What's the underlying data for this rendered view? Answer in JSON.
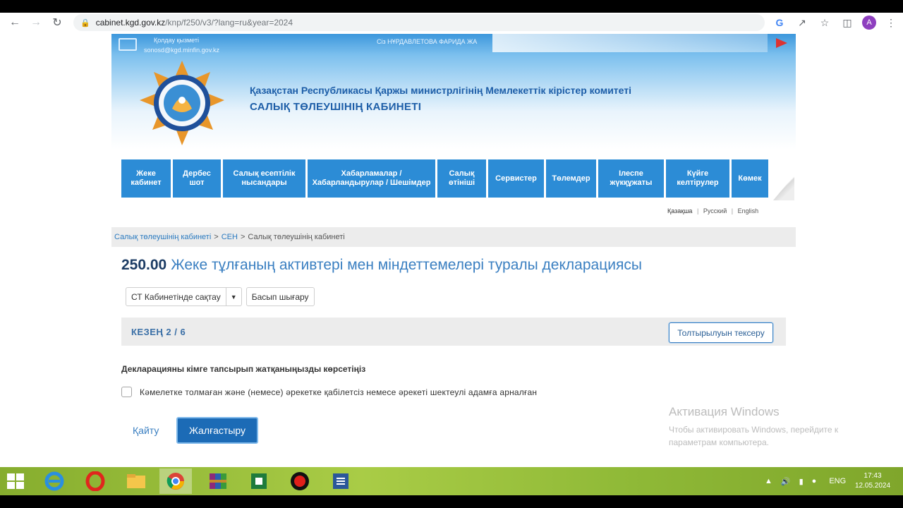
{
  "browser": {
    "url_host": "cabinet.kgd.gov.kz",
    "url_path": "/knp/f250/v3/?lang=ru&year=2024",
    "avatar_letter": "A"
  },
  "header": {
    "support_title": "Қолдау қызметі",
    "support_email": "sonosd@kgd.minfin.gov.kz",
    "user_line": "Сіз НҰРДАВЛЕТОВА ФАРИДА ЖА",
    "title_line1": "Қазақстан Республикасы Қаржы министрлігінің Мемлекеттік кірістер комитеті",
    "title_line2": "САЛЫҚ ТӨЛЕУШІНІҢ КАБИНЕТІ"
  },
  "menu": {
    "items": [
      {
        "label": "Жеке кабинет"
      },
      {
        "label": "Дербес шот"
      },
      {
        "label": "Салық есептілік нысандары"
      },
      {
        "label": "Хабарламалар / Хабарландырулар / Шешімдер"
      },
      {
        "label": "Салық өтініші"
      },
      {
        "label": "Сервистер"
      },
      {
        "label": "Төлемдер"
      },
      {
        "label": "Ілеспе жүкқұжаты"
      },
      {
        "label": "Күйге келтірулер"
      },
      {
        "label": "Көмек"
      }
    ]
  },
  "languages": {
    "kazakh": "Қазақша",
    "russian": "Русский",
    "english": "English",
    "separator": "|"
  },
  "breadcrumb": {
    "item1": "Салық төлеушінің кабинеті",
    "item2": "СЕН",
    "item3": "Салық төлеушінің кабинеті",
    "separator": ">"
  },
  "form": {
    "code": "250.00",
    "title": "Жеке тұлғаның активтері мен міндеттемелері туралы декларациясы",
    "save_label": "СТ Кабинетінде сақтау",
    "print_label": "Басып шығару",
    "stage_label": "КЕЗЕҢ 2 / 6",
    "check_label": "Толтырылуын тексеру",
    "question": "Декларацияны кімге тапсырып жатқаныңызды көрсетіңіз",
    "checkbox_label": "Кәмелетке толмаған және (немесе) әрекетке қабілетсіз немесе әрекеті шектеулі адамға арналған",
    "back_label": "Қайту",
    "continue_label": "Жалғастыру"
  },
  "watermark": {
    "title": "Активация Windows",
    "line1": "Чтобы активировать Windows, перейдите к",
    "line2": "параметрам компьютера."
  },
  "taskbar": {
    "lang": "ENG",
    "time": "17:43",
    "date": "12.05.2024"
  }
}
